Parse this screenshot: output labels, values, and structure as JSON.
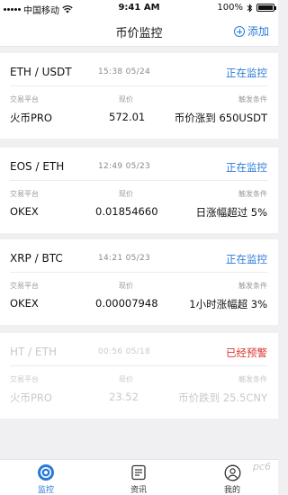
{
  "status_bar": {
    "carrier": "中国移动",
    "time": "9:41 AM",
    "battery": "100%"
  },
  "header": {
    "title": "币价监控",
    "add_label": "添加"
  },
  "columns": {
    "platform": "交易平台",
    "price": "现价",
    "condition": "触发条件"
  },
  "alerts": [
    {
      "pair": "ETH / USDT",
      "time": "15:38  05/24",
      "status": "正在监控",
      "platform": "火币PRO",
      "price": "572.01",
      "condition": "币价涨到 650USDT"
    },
    {
      "pair": "EOS / ETH",
      "time": "12:49  05/23",
      "status": "正在监控",
      "platform": "OKEX",
      "price": "0.01854660",
      "condition": "日涨幅超过 5%"
    },
    {
      "pair": "XRP / BTC",
      "time": "14:21  05/23",
      "status": "正在监控",
      "platform": "OKEX",
      "price": "0.00007948",
      "condition": "1小时涨幅超 3%"
    },
    {
      "pair": "HT / ETH",
      "time": "00:56  05/18",
      "status": "已经预警",
      "platform": "火币PRO",
      "price": "23.52",
      "condition": "币价跌到 25.5CNY"
    }
  ],
  "tabs": [
    {
      "label": "监控",
      "icon": "monitor-icon"
    },
    {
      "label": "资讯",
      "icon": "news-icon"
    },
    {
      "label": "我的",
      "icon": "profile-icon"
    }
  ],
  "colors": {
    "accent": "#2a7ad8",
    "alert": "#d9332e",
    "background": "#f0f0f2"
  },
  "watermark": "pc6"
}
